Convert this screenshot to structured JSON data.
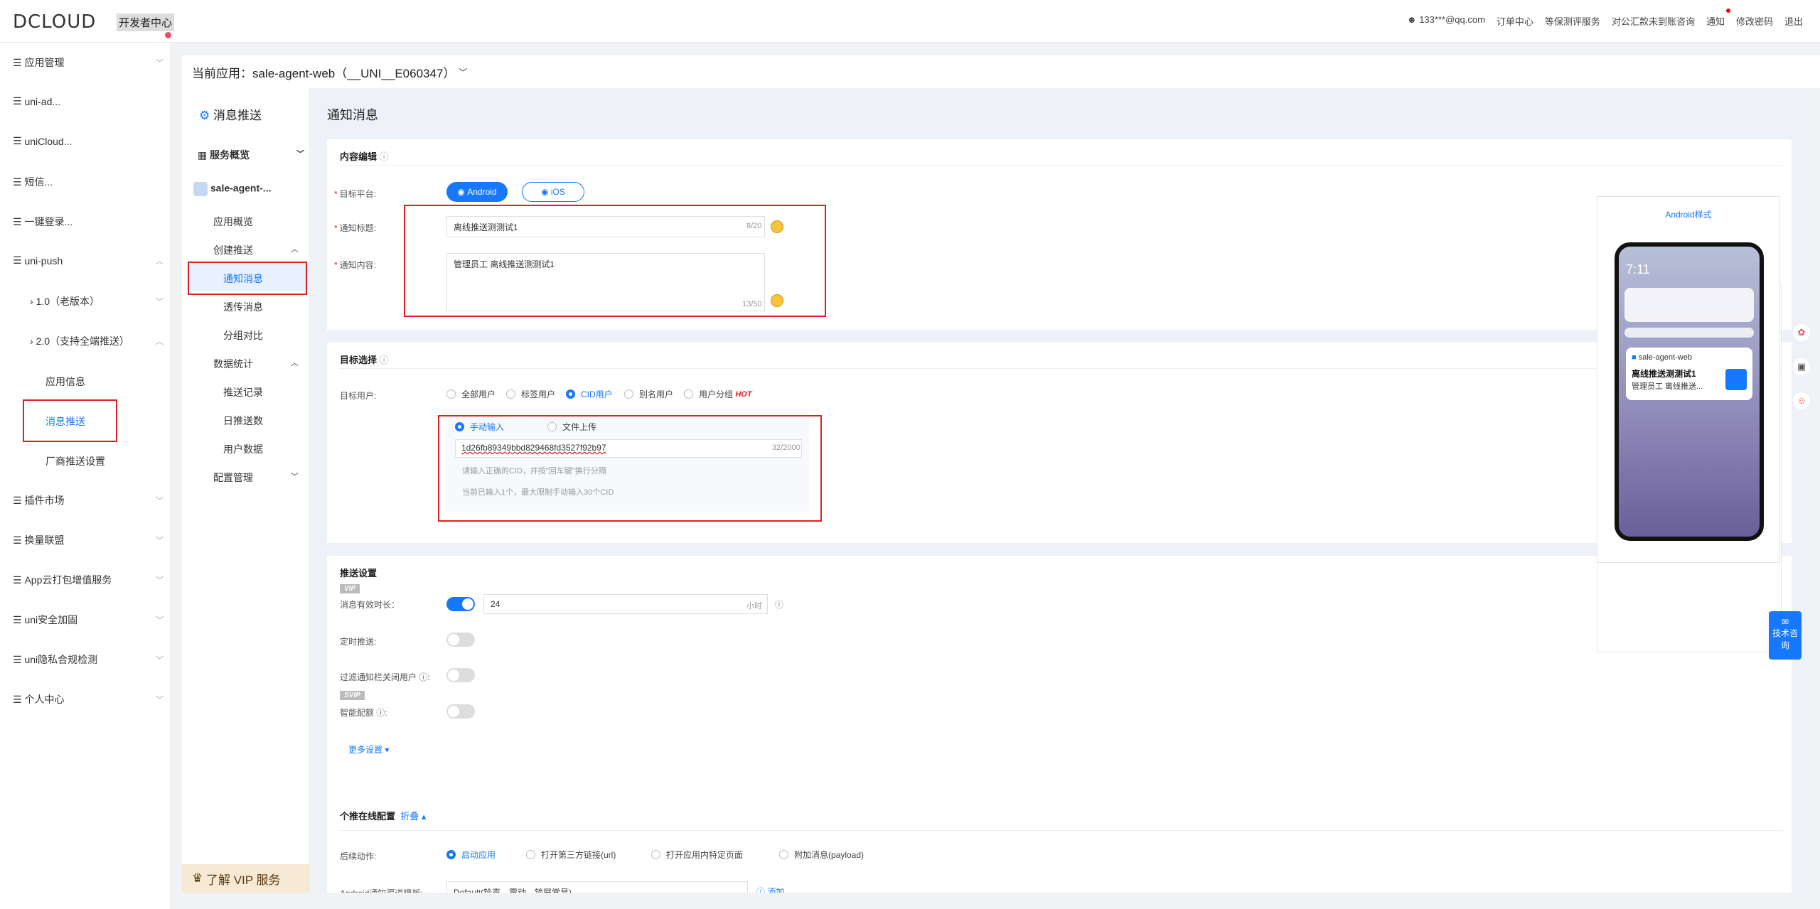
{
  "header": {
    "logo": "DCLOUD",
    "logo_sub": "开发者中心",
    "links": [
      "133***@qq.com",
      "订单中心",
      "等保测评服务",
      "对公汇款未到账咨询",
      "通知",
      "修改密码",
      "退出"
    ]
  },
  "sidebar": {
    "items": [
      {
        "label": "应用管理",
        "chev": "﹀"
      },
      {
        "label": "uni-ad..."
      },
      {
        "label": "uniCloud..."
      },
      {
        "label": "短信..."
      },
      {
        "label": "一键登录..."
      },
      {
        "label": "uni-push",
        "chev": "︿"
      },
      {
        "label": "插件市场",
        "chev": "﹀"
      },
      {
        "label": "换量联盟",
        "chev": "﹀"
      },
      {
        "label": "App云打包增值服务",
        "chev": "﹀"
      },
      {
        "label": "uni安全加固",
        "chev": "﹀"
      },
      {
        "label": "uni隐私合规检测",
        "chev": "﹀"
      },
      {
        "label": "个人中心",
        "chev": "﹀"
      }
    ],
    "push_sub": [
      "1.0（老版本）",
      "2.0（支持全端推送）"
    ],
    "push_v2": [
      "应用信息",
      "消息推送",
      "厂商推送设置"
    ]
  },
  "app_selector": "当前应用：sale-agent-web（__UNI__E060347）",
  "sub_sidebar": {
    "title": "消息推送",
    "overview": "服务概览",
    "app": "sale-agent-...",
    "app_overview": "应用概览",
    "create": "创建推送",
    "notify": "通知消息",
    "transmit": "透传消息",
    "group": "分组对比",
    "stats": "数据统计",
    "records": "推送记录",
    "daily": "日推送数",
    "users": "用户数据",
    "config": "配置管理",
    "vip": "了解 VIP 服务"
  },
  "page_title": "通知消息",
  "content_edit": {
    "title": "内容编辑",
    "platform_label": "目标平台:",
    "android": "Android",
    "ios": "iOS",
    "title_label": "通知标题:",
    "title_value": "离线推送测测试1",
    "title_count": "8/20",
    "body_label": "通知内容:",
    "body_value": "管理员工 离线推送测测试1",
    "body_count": "13/50"
  },
  "target": {
    "title": "目标选择",
    "user_label": "目标用户:",
    "options": [
      "全部用户",
      "标签用户",
      "CID用户",
      "别名用户",
      "用户分组"
    ],
    "hot": "HOT",
    "manual": "手动输入",
    "upload": "文件上传",
    "cid_value": "1d26fb89349bbd829468fd3527f92b97",
    "cid_count": "32/2000",
    "hint1": "请输入正确的CID，并按\"回车键\"换行分隔",
    "hint2": "当前已输入1个，最大限制手动输入30个CID"
  },
  "settings": {
    "title": "推送设置",
    "vip": "VIP",
    "svip": "SVIP",
    "ttl_label": "消息有效时长：",
    "ttl_value": "24",
    "ttl_unit": "小时",
    "schedule_label": "定时推送:",
    "filter_label": "过滤通知栏关闭用户 ⓘ:",
    "smart_label": "智能配额 ⓘ:",
    "more": "更多设置 ▾"
  },
  "online": {
    "title": "个推在线配置",
    "fold": "折叠 ▴",
    "action_label": "后续动作:",
    "actions": [
      "启动应用",
      "打开第三方链接(url)",
      "打开应用内特定页面",
      "附加消息(payload)"
    ],
    "tpl_label": "Android通知渠道模板:",
    "tpl_value": "Default(铃声、震动、锁屏常显)",
    "add": "添加"
  },
  "preview": {
    "title": "Android样式",
    "time": "7:11",
    "app": "sale-agent-web",
    "notif_title": "离线推送测测试1",
    "notif_body": "管理员工 离线推送..."
  },
  "float": {
    "consult": "技术咨询"
  }
}
